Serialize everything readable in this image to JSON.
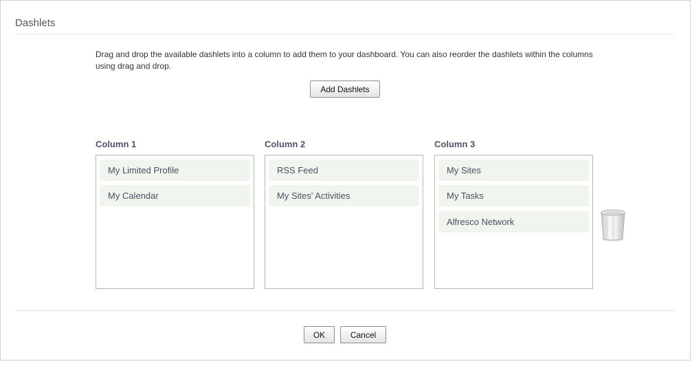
{
  "section": {
    "title": "Dashlets"
  },
  "instructions": "Drag and drop the available dashlets into a column to add them to your dashboard. You can also reorder the dashlets within the columns using drag and drop.",
  "buttons": {
    "add_dashlets": "Add Dashlets",
    "ok": "OK",
    "cancel": "Cancel"
  },
  "columns": [
    {
      "title": "Column 1",
      "dashlets": [
        "My Limited Profile",
        "My Calendar"
      ]
    },
    {
      "title": "Column 2",
      "dashlets": [
        "RSS Feed",
        "My Sites' Activities"
      ]
    },
    {
      "title": "Column 3",
      "dashlets": [
        "My Sites",
        "My Tasks",
        "Alfresco Network"
      ]
    }
  ],
  "icons": {
    "trash": "trash-can-icon"
  }
}
